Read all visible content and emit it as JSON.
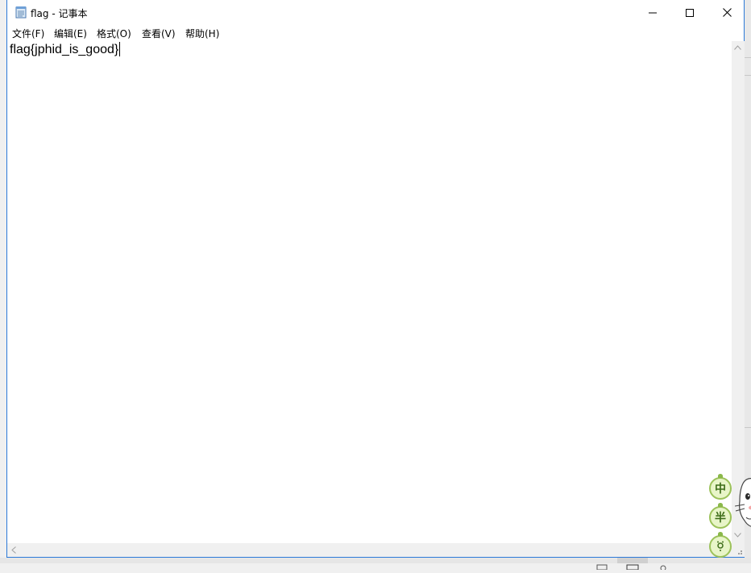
{
  "window": {
    "title": "flag - 记事本"
  },
  "menu": {
    "items": [
      {
        "label": "文件(F)"
      },
      {
        "label": "编辑(E)"
      },
      {
        "label": "格式(O)"
      },
      {
        "label": "查看(V)"
      },
      {
        "label": "帮助(H)"
      }
    ]
  },
  "editor": {
    "content": "flag{jphid_is_good}"
  },
  "ime": {
    "mode_label": "中",
    "width_label": "半"
  },
  "colors": {
    "window_border": "#2b79d8",
    "ime_green": "#9cc25a"
  }
}
